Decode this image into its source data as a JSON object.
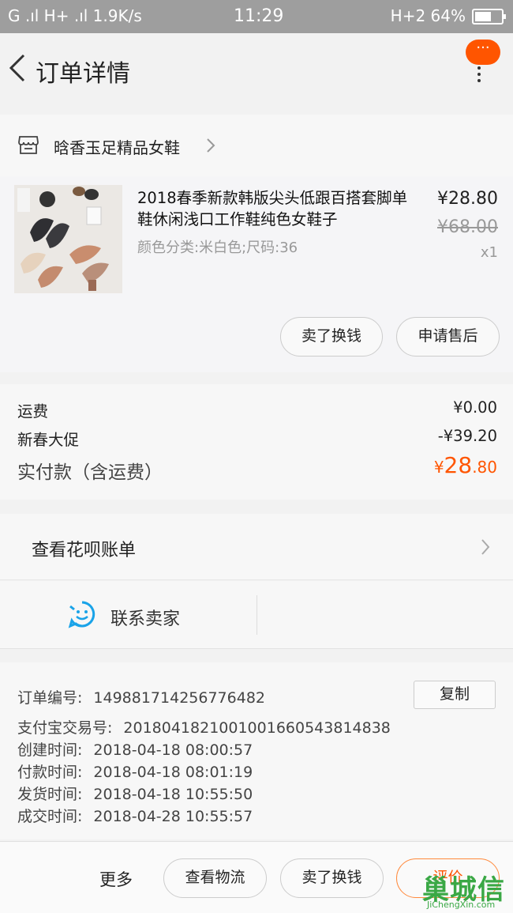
{
  "status_bar": {
    "left": "G .ıl  H+ .ıl  1.9K/s",
    "time": "11:29",
    "right": "H+2  64%",
    "battery_percent": 64
  },
  "header": {
    "title": "订单详情",
    "more_bubble": "···"
  },
  "shop": {
    "name": "晗香玉足精品女鞋"
  },
  "product": {
    "title": "2018春季新款韩版尖头低跟百搭套脚单鞋休闲浅口工作鞋纯色女鞋子",
    "spec": "颜色分类:米白色;尺码:36",
    "price": "¥28.80",
    "original_price": "¥68.00",
    "quantity": "x1",
    "sell_button": "卖了换钱",
    "aftersale_button": "申请售后"
  },
  "fees": {
    "shipping_label": "运费",
    "shipping_value": "¥0.00",
    "promo_label": "新春大促",
    "promo_value": "-¥39.20",
    "total_label": "实付款（含运费）",
    "total_currency": "¥",
    "total_int": "28",
    "total_dec": ".80"
  },
  "huabei": {
    "label": "查看花呗账单"
  },
  "contact": {
    "label": "联系卖家"
  },
  "order_info": {
    "copy_button": "复制",
    "rows": [
      {
        "label": "订单编号:",
        "value": "149881714256776482"
      },
      {
        "label": "支付宝交易号:",
        "value": "2018041821001001660543814838"
      },
      {
        "label": "创建时间:",
        "value": "2018-04-18 08:00:57"
      },
      {
        "label": "付款时间:",
        "value": "2018-04-18 08:01:19"
      },
      {
        "label": "发货时间:",
        "value": "2018-04-18 10:55:50"
      },
      {
        "label": "成交时间:",
        "value": "2018-04-28 10:55:57"
      }
    ]
  },
  "bottom_bar": {
    "more": "更多",
    "logistics": "查看物流",
    "sell": "卖了换钱",
    "review": "评价"
  },
  "watermark": {
    "text": "巢城信",
    "sub": "JiChengXin.com"
  }
}
